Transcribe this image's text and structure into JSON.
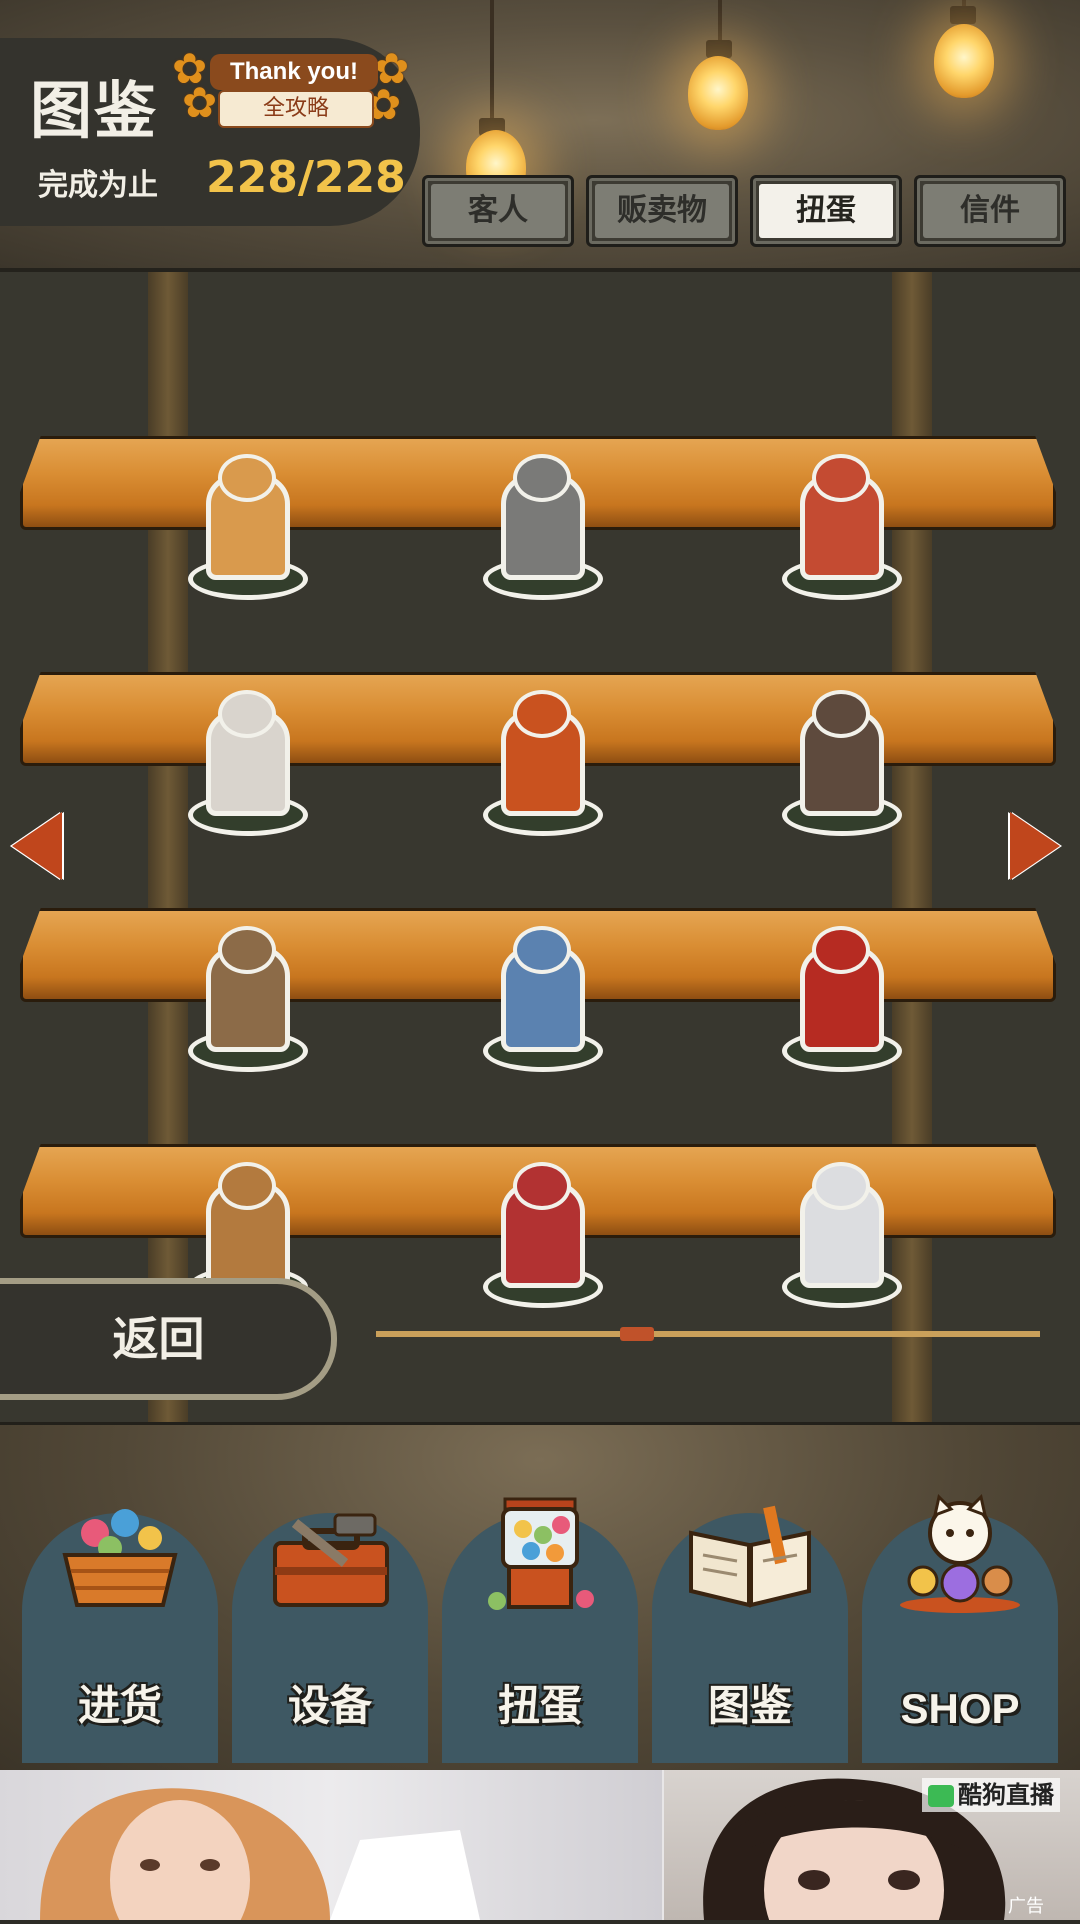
{
  "header": {
    "title": "图鉴",
    "badge_top": "Thank you!",
    "badge_bottom": "全攻略",
    "complete_label": "完成为止",
    "complete_count": "228/228"
  },
  "tabs": [
    {
      "label": "客人",
      "active": false
    },
    {
      "label": "贩卖物",
      "active": false
    },
    {
      "label": "扭蛋",
      "active": true
    },
    {
      "label": "信件",
      "active": false
    }
  ],
  "shelf_items": [
    {
      "name": "cat-with-pot",
      "color": "#d99a4d"
    },
    {
      "name": "cat-with-door",
      "color": "#7a7a78"
    },
    {
      "name": "cat-on-tv",
      "color": "#c44b32"
    },
    {
      "name": "cat-with-flowers",
      "color": "#d9d4cd"
    },
    {
      "name": "cat-on-postbox",
      "color": "#c9521f"
    },
    {
      "name": "cat-with-window",
      "color": "#5e4a3d"
    },
    {
      "name": "cat-on-table",
      "color": "#8c6b48"
    },
    {
      "name": "cat-with-lantern",
      "color": "#5b82b0"
    },
    {
      "name": "cat-in-phone-booth",
      "color": "#b62b22"
    },
    {
      "name": "cat-with-bucket",
      "color": "#b37a3e"
    },
    {
      "name": "cat-on-kotatsu",
      "color": "#b23232"
    },
    {
      "name": "cat-in-snow",
      "color": "#dcdde0"
    }
  ],
  "back_label": "返回",
  "bottom_nav": [
    {
      "label": "进货",
      "icon": "goods-basket-icon"
    },
    {
      "label": "设备",
      "icon": "toolbox-icon"
    },
    {
      "label": "扭蛋",
      "icon": "gacha-machine-icon"
    },
    {
      "label": "图鉴",
      "icon": "book-icon"
    },
    {
      "label": "SHOP",
      "icon": "lucky-cat-icon"
    }
  ],
  "ad": {
    "brand": "酷狗直播",
    "tag": "广告"
  },
  "colors": {
    "accent_yellow": "#f2c34a",
    "arrow_red": "#c0461c",
    "shelf_wood": "#d98d33"
  }
}
